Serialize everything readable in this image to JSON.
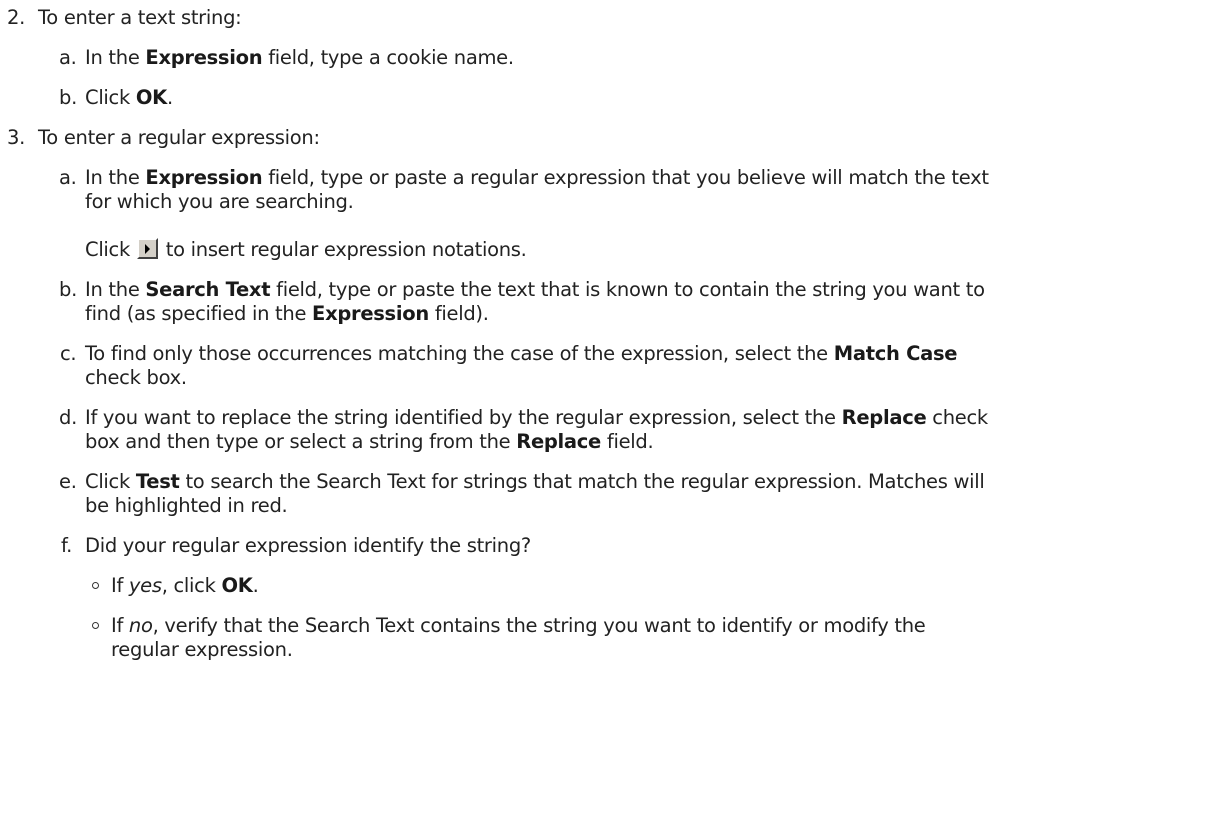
{
  "step2": {
    "marker": "2.",
    "text": "To enter a text string:",
    "a": {
      "marker": "a.",
      "pre": "In the ",
      "bold": "Expression",
      "post": " field, type a cookie name."
    },
    "b": {
      "marker": "b.",
      "pre": "Click ",
      "bold": "OK",
      "post": "."
    }
  },
  "step3": {
    "marker": "3.",
    "text": "To enter a regular expression:",
    "a": {
      "marker": "a.",
      "pre": "In the ",
      "bold": "Expression",
      "post": " field, type or paste a regular expression that you believe will match the text",
      "line2": "for which you are searching.",
      "note_pre": "Click ",
      "note_icon": "insert-regex-arrow-icon",
      "note_post": " to insert regular expression notations."
    },
    "b": {
      "marker": "b.",
      "pre": "In the ",
      "bold": "Search Text",
      "post": " field, type or paste the text that is known to contain the string you want to",
      "line2_pre": "find (as specified in the ",
      "line2_bold": "Expression",
      "line2_post": " field)."
    },
    "c": {
      "marker": "c.",
      "pre": "To find only those occurrences matching the case of the expression, select the ",
      "bold": "Match Case",
      "line2": "check box."
    },
    "d": {
      "marker": "d.",
      "pre": "If you want to replace the string identified by the regular expression, select the ",
      "bold": "Replace",
      "post": " check",
      "line2_pre": "box and then type or select a string from the ",
      "line2_bold": "Replace",
      "line2_post": " field."
    },
    "e": {
      "marker": "e.",
      "pre": "Click ",
      "bold": "Test",
      "post": " to search the Search Text for strings that match the regular expression. Matches will",
      "line2": "be highlighted in red."
    },
    "f": {
      "marker": "f.",
      "text": "Did your regular expression identify the string?",
      "yes": {
        "pre": "If ",
        "italic": "yes",
        "mid": ", click ",
        "bold": "OK",
        "post": "."
      },
      "no": {
        "pre": "If ",
        "italic": "no",
        "post": ", verify that the Search Text contains the string you want to identify or modify the",
        "line2": "regular expression."
      }
    }
  }
}
